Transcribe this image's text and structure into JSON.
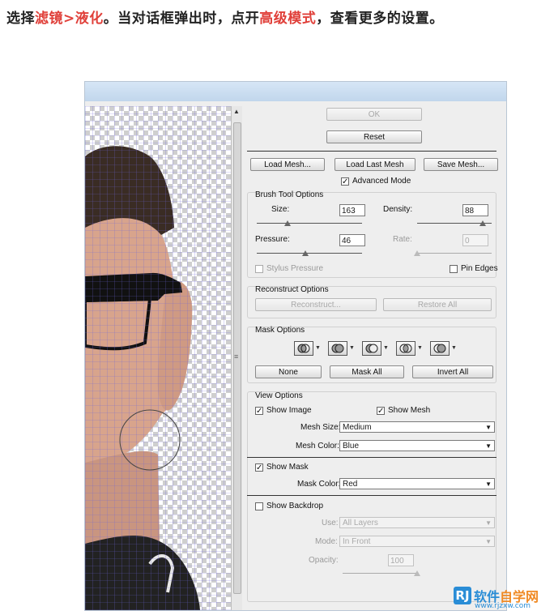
{
  "caption": {
    "part1": "选择",
    "highlight1": "滤镜>液化",
    "part2": "。当对话框弹出时，点开",
    "highlight2": "高级模式",
    "part3": "，查看更多的设置。"
  },
  "buttons": {
    "ok": "OK",
    "reset": "Reset",
    "load_mesh": "Load Mesh...",
    "load_last_mesh": "Load Last Mesh",
    "save_mesh": "Save Mesh..."
  },
  "advanced_mode": {
    "label": "Advanced Mode",
    "checked": true
  },
  "brush_tool_options": {
    "title": "Brush Tool Options",
    "size": {
      "label": "Size:",
      "value": "163",
      "fraction": 0.29
    },
    "density": {
      "label": "Density:",
      "value": "88",
      "fraction": 0.88
    },
    "pressure": {
      "label": "Pressure:",
      "value": "46",
      "fraction": 0.46
    },
    "rate": {
      "label": "Rate:",
      "value": "0",
      "fraction": 0.0
    },
    "stylus_pressure": "Stylus Pressure",
    "pin_edges": "Pin Edges"
  },
  "reconstruct_options": {
    "title": "Reconstruct Options",
    "reconstruct": "Reconstruct...",
    "restore_all": "Restore All"
  },
  "mask_options": {
    "title": "Mask Options",
    "none": "None",
    "mask_all": "Mask All",
    "invert_all": "Invert All"
  },
  "view_options": {
    "title": "View Options",
    "show_image": "Show Image",
    "show_mesh": "Show Mesh",
    "mesh_size_label": "Mesh Size:",
    "mesh_size_value": "Medium",
    "mesh_color_label": "Mesh Color:",
    "mesh_color_value": "Blue",
    "show_mask": "Show Mask",
    "mask_color_label": "Mask Color:",
    "mask_color_value": "Red",
    "show_backdrop": "Show Backdrop",
    "use_label": "Use:",
    "use_value": "All Layers",
    "mode_label": "Mode:",
    "mode_value": "In Front",
    "opacity_label": "Opacity:",
    "opacity_value": "100",
    "opacity_fraction": 1.0
  },
  "watermark": {
    "mark": "RJ",
    "name_part1": "软件",
    "name_part2": "自学网",
    "url": "www.rjzxw.com"
  },
  "colors": {
    "highlight": "#e0403a",
    "mesh": "#6b63d8",
    "titlebar": "#c1d6ec",
    "brand": "#2a8dd6"
  }
}
